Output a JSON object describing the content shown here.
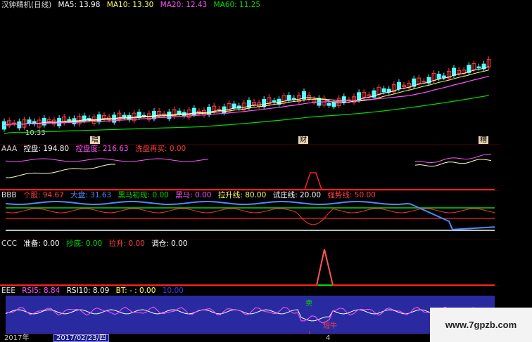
{
  "main": {
    "title": "汉钟精机(日线)",
    "ma5_label": "MA5:",
    "ma5": "13.98",
    "ma10_label": "MA10:",
    "ma10": "13.30",
    "ma20_label": "MA20:",
    "ma20": "12.43",
    "ma60_label": "MA60:",
    "ma60": "11.25",
    "low_label": "10.33",
    "markers": [
      "增",
      "财",
      "糟"
    ]
  },
  "aaa": {
    "name": "AAA",
    "kongpan_label": "控盘:",
    "kongpan": "194.80",
    "kongpandu_label": "控盘度:",
    "kongpandu": "216.63",
    "xipan_label": "洗盘再买:",
    "xipan": "0.00"
  },
  "bbb": {
    "name": "BBB",
    "gegu_label": "个股:",
    "gegu": "94.67",
    "dapan_label": "大盘:",
    "dapan": "31.63",
    "heima_chu_label": "黑马初现:",
    "heima_chu": "0.00",
    "heima_label": "黑马:",
    "heima": "0.00",
    "lasheng_label": "拉升线:",
    "lasheng": "80.00",
    "shizhuang_label": "试庄线:",
    "shizhuang": "20.00",
    "qiangshi_label": "强势线:",
    "qiangshi": "50.00"
  },
  "ccc": {
    "name": "CCC",
    "zhunbei_label": "准备:",
    "zhunbei": "0.00",
    "chaodi_label": "抄底:",
    "chaodi": "0.00",
    "lasheng_label": "拉升:",
    "lasheng": "0.00",
    "tiaocang_label": "调仓:",
    "tiaocang": "0.00"
  },
  "eee": {
    "name": "EEE",
    "rsi5_label": "RSI5:",
    "rsi5": "8.84",
    "rsi10_label": "RSI10:",
    "rsi10": "8.09",
    "bt_label": "BT:",
    "bt": "- : 0.00",
    "extra": "10.00",
    "sell_label": "卖",
    "short_label": "短牛"
  },
  "datebar": {
    "year": "2017年",
    "date": "2017/02/23/四",
    "idx": "4"
  },
  "watermark": "www.7gpzb.com",
  "colors": {
    "background": "#000000",
    "up_candle": "#ff4040",
    "down_candle": "#54ffff",
    "ma5": "#ffffff",
    "ma10": "#ffff66",
    "ma20": "#ff55ff",
    "ma60": "#00dd00",
    "rsi_panel_bg": "#2a2aa0"
  }
}
